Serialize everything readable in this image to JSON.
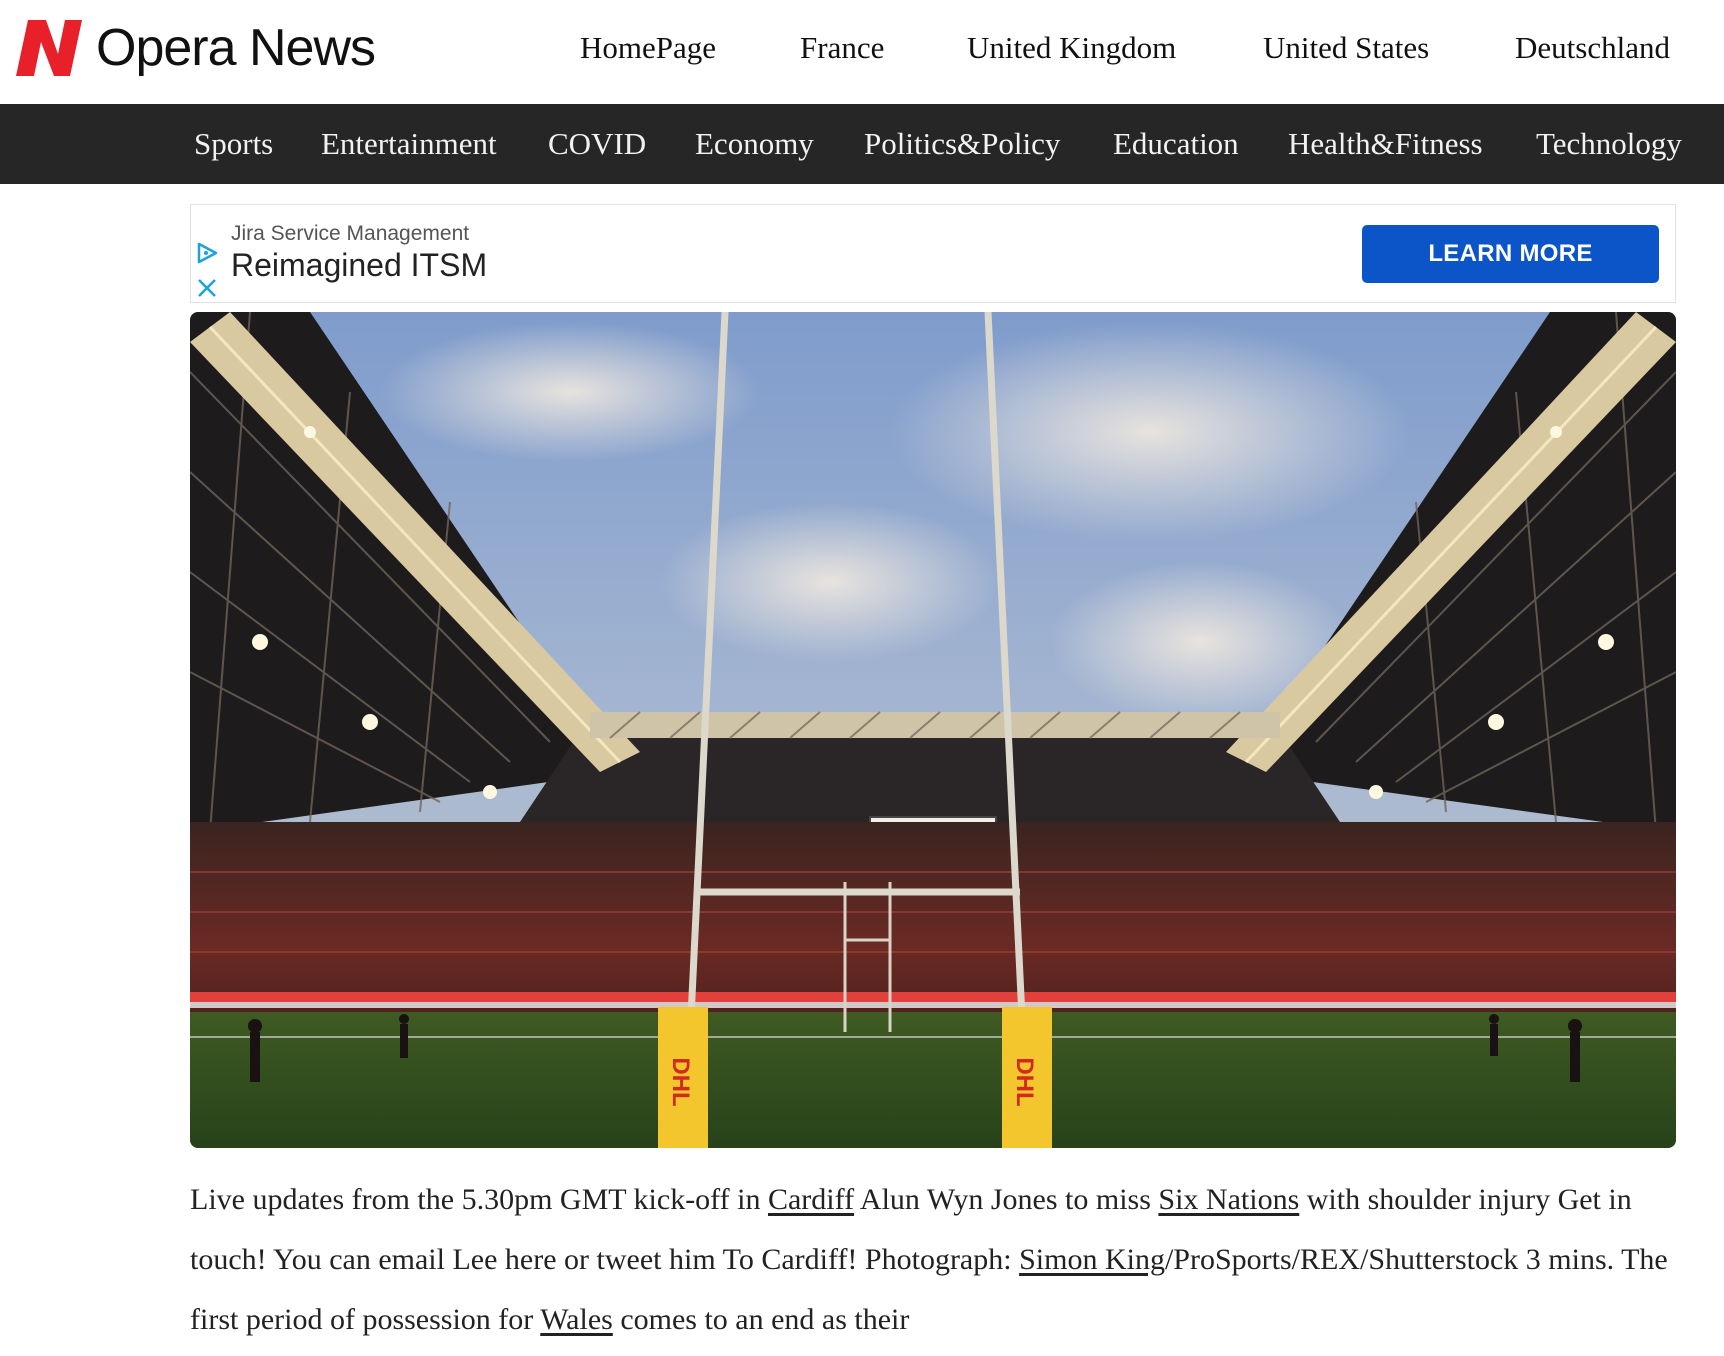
{
  "brand": {
    "name": "Opera News",
    "logo_icon": "opera-news-n-logo",
    "accent": "#e8202a"
  },
  "top_nav": [
    "HomePage",
    "France",
    "United Kingdom",
    "United States",
    "Deutschland"
  ],
  "categories": [
    "Sports",
    "Entertainment",
    "COVID",
    "Economy",
    "Politics&Policy",
    "Education",
    "Health&Fitness",
    "Technology"
  ],
  "ad": {
    "advertiser": "Jira Service Management",
    "headline": "Reimagined ITSM",
    "cta": "LEARN MORE",
    "cta_color": "#0b55c8",
    "icons": [
      "ad-choices-icon",
      "close-icon"
    ]
  },
  "hero": {
    "sign_text": "DHL"
  },
  "article": {
    "p1": "Live updates from the 5.30pm GMT kick-off in ",
    "link_cardiff": "Cardiff",
    "p2": " Alun Wyn Jones to miss ",
    "link_six_nations": "Six Nations",
    "p3": " with shoulder injury Get in touch! You can email Lee here or tweet him To Cardiff! Photograph: ",
    "link_photographer": "Simon King",
    "p4": "/ProSports/REX/Shutterstock 3 mins. The first period of possession for ",
    "link_wales": "Wales",
    "p5": " comes to an end as their"
  }
}
